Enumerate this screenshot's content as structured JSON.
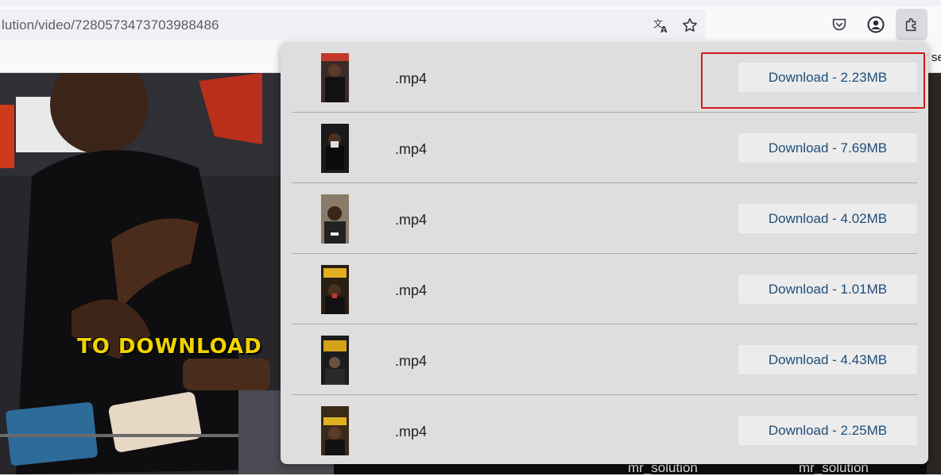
{
  "browser": {
    "url": "lution/video/7280573473703988486",
    "bookmark_cutoff": "se",
    "icons": {
      "translate": "translate-icon",
      "star": "bookmark-star-icon",
      "pocket": "pocket-icon",
      "account": "account-icon",
      "extensions": "extensions-puzzle-icon"
    }
  },
  "video": {
    "caption": "TO DOWNLOAD",
    "bottom_labels": [
      "mr_solution",
      "mr_solution"
    ]
  },
  "popup": {
    "items": [
      {
        "ext": ".mp4",
        "button": "Download - 2.23MB"
      },
      {
        "ext": ".mp4",
        "button": "Download - 7.69MB"
      },
      {
        "ext": ".mp4",
        "button": "Download - 4.02MB"
      },
      {
        "ext": ".mp4",
        "button": "Download - 1.01MB"
      },
      {
        "ext": ".mp4",
        "button": "Download - 4.43MB"
      },
      {
        "ext": ".mp4",
        "button": "Download - 2.25MB"
      }
    ]
  },
  "colors": {
    "highlight": "#d01818",
    "button_text": "#1f4e79",
    "caption": "#f2d400"
  }
}
